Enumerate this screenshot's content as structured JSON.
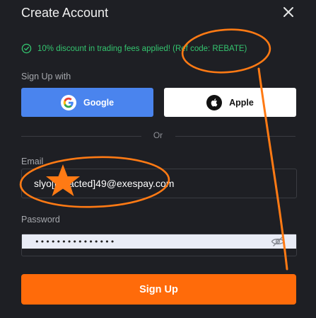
{
  "modal": {
    "title": "Create Account",
    "close_icon": "close-icon"
  },
  "promo": {
    "text": "10% discount in trading fees applied! (Ref code: REBATE)",
    "icon": "check-circle-icon",
    "color": "#34c56f"
  },
  "signup_with": {
    "label": "Sign Up with",
    "google_label": "Google",
    "apple_label": "Apple",
    "google_color": "#4a84ee",
    "apple_color": "#ffffff"
  },
  "divider": {
    "or_label": "Or"
  },
  "email": {
    "label": "Email",
    "value": "slyo[redacted]49@exespay.com"
  },
  "password": {
    "label": "Password",
    "value": "•••••••••••••••",
    "toggle_icon": "eye-off-icon"
  },
  "submit": {
    "label": "Sign Up",
    "color": "#ff6b0a"
  },
  "annotation": {
    "color": "#ff7a14"
  }
}
